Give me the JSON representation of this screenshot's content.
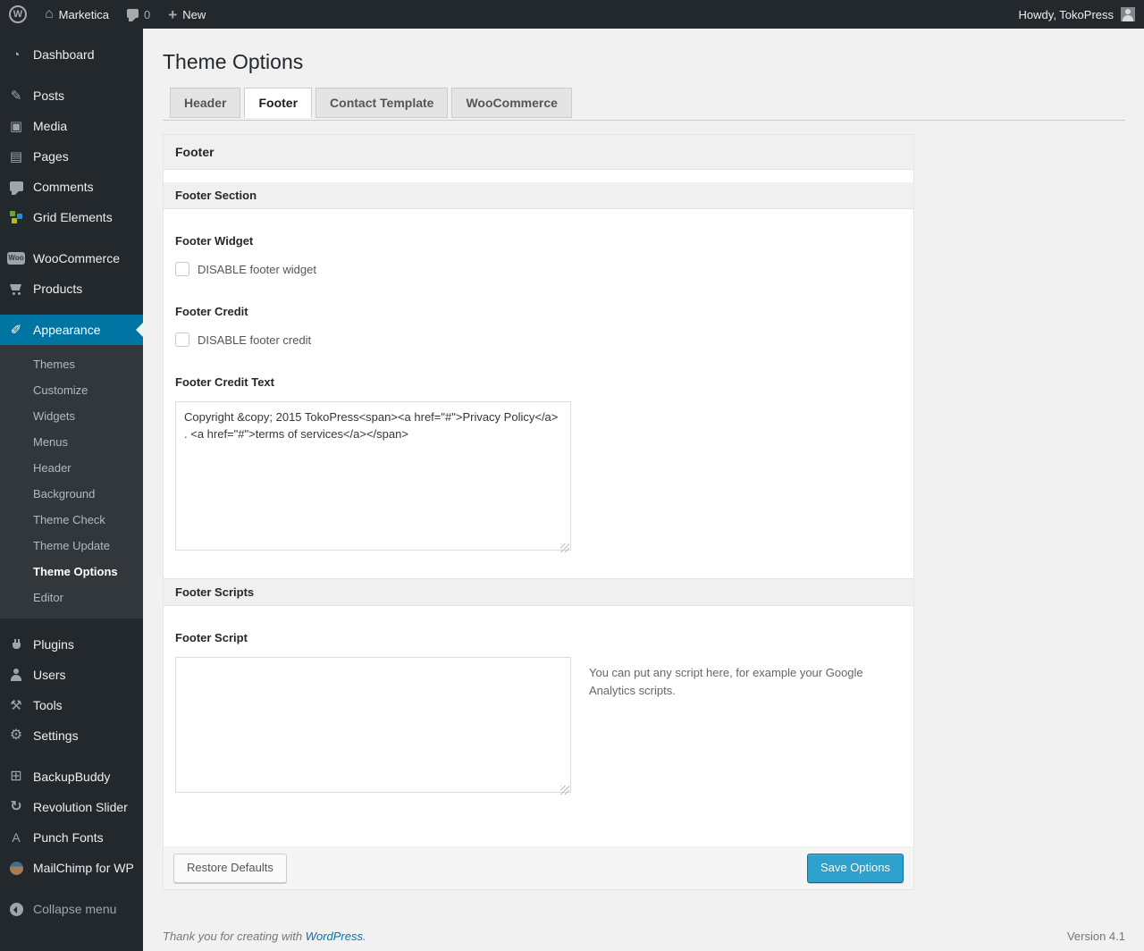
{
  "admin_bar": {
    "wp_logo_letter": "W",
    "site_name": "Marketica",
    "comment_count": "0",
    "new_label": "New",
    "howdy": "Howdy, TokoPress"
  },
  "sidebar": {
    "group_a": [
      {
        "label": "Dashboard"
      }
    ],
    "group_b": [
      {
        "label": "Posts"
      },
      {
        "label": "Media"
      },
      {
        "label": "Pages"
      },
      {
        "label": "Comments"
      },
      {
        "label": "Grid Elements"
      }
    ],
    "woo_badge": "Woo",
    "group_c": [
      {
        "label": "WooCommerce"
      },
      {
        "label": "Products"
      }
    ],
    "appearance": {
      "label": "Appearance",
      "submenu": [
        "Themes",
        "Customize",
        "Widgets",
        "Menus",
        "Header",
        "Background",
        "Theme Check",
        "Theme Update",
        "Theme Options",
        "Editor"
      ],
      "current_submenu": "Theme Options"
    },
    "group_d": [
      {
        "label": "Plugins"
      },
      {
        "label": "Users"
      },
      {
        "label": "Tools"
      },
      {
        "label": "Settings"
      }
    ],
    "group_e": [
      {
        "label": "BackupBuddy"
      },
      {
        "label": "Revolution Slider"
      },
      {
        "label": "Punch Fonts"
      },
      {
        "label": "MailChimp for WP"
      }
    ],
    "collapse_label": "Collapse menu"
  },
  "page": {
    "title": "Theme Options",
    "tabs": [
      {
        "label": "Header",
        "active": false
      },
      {
        "label": "Footer",
        "active": true
      },
      {
        "label": "Contact Template",
        "active": false
      },
      {
        "label": "WooCommerce",
        "active": false
      }
    ]
  },
  "panel": {
    "group_title": "Footer",
    "footer_section_title": "Footer Section",
    "footer_widget_label": "Footer Widget",
    "footer_widget_checkbox_label": "DISABLE footer widget",
    "footer_widget_checked": false,
    "footer_credit_label": "Footer Credit",
    "footer_credit_checkbox_label": "DISABLE footer credit",
    "footer_credit_checked": false,
    "footer_credit_text_label": "Footer Credit Text",
    "footer_credit_text_value": "Copyright &copy; 2015 TokoPress<span><a href=\"#\">Privacy Policy</a> . <a href=\"#\">terms of services</a></span>",
    "footer_scripts_title": "Footer Scripts",
    "footer_script_label": "Footer Script",
    "footer_script_value": "",
    "footer_script_help": "You can put any script here, for example your Google Analytics scripts.",
    "restore_button": "Restore Defaults",
    "save_button": "Save Options"
  },
  "footer": {
    "thanks_prefix": "Thank you for creating with ",
    "wordpress_link": "WordPress",
    "period": ".",
    "version": "Version 4.1"
  },
  "colors": {
    "admin_bar_bg": "#23282d",
    "sidebar_bg": "#23282d",
    "submenu_bg": "#32373c",
    "highlight_blue": "#0074a2",
    "primary_button": "#2ea2cc",
    "link_blue": "#0073aa",
    "page_bg": "#f1f1f1"
  }
}
